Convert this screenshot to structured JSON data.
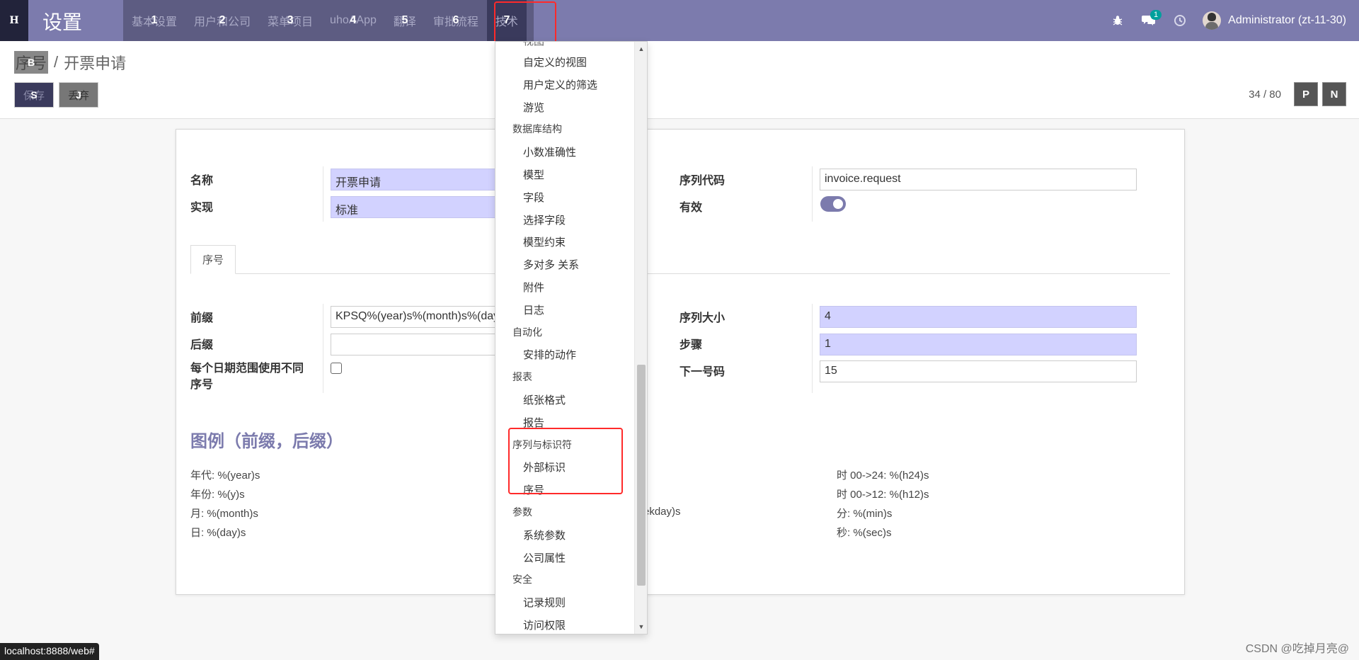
{
  "topbar": {
    "apps_hint": "H",
    "brand": "设置",
    "menus": [
      {
        "label": "基本设置",
        "hint": "1"
      },
      {
        "label": "用户和公司",
        "hint": "2"
      },
      {
        "label": "菜单项目",
        "hint": "3"
      },
      {
        "label": "uhoAApp",
        "hint": "4"
      },
      {
        "label": "翻译",
        "hint": "5"
      },
      {
        "label": "审批流程",
        "hint": "6"
      },
      {
        "label": "技术",
        "hint": "7"
      }
    ],
    "chat_badge": "1",
    "user_name": "Administrator (zt-11-30)"
  },
  "control": {
    "breadcrumb_parent": "序号",
    "breadcrumb_parent_hint": "B",
    "breadcrumb_sep": "/",
    "breadcrumb_current": "开票申请",
    "save_label": "保存",
    "save_hint": "S",
    "discard_label": "丢弃",
    "discard_hint": "J",
    "pager_text": "34 / 80",
    "pager_prev": "P",
    "pager_next": "N"
  },
  "form": {
    "name_label": "名称",
    "name_value": "开票申请",
    "impl_label": "实现",
    "impl_value": "标准",
    "code_label": "序列代码",
    "code_value": "invoice.request",
    "active_label": "有效",
    "tab_label": "序号",
    "prefix_label": "前缀",
    "prefix_value": "KPSQ%(year)s%(month)s%(day)s",
    "suffix_label": "后缀",
    "suffix_value": "",
    "date_range_label": "每个日期范围使用不同序号",
    "size_label": "序列大小",
    "size_value": "4",
    "step_label": "步骤",
    "step_value": "1",
    "next_label": "下一号码",
    "next_value": "15",
    "legend_title": "图例（前缀，后缀）",
    "legend_col1": [
      "年代: %(year)s",
      "年份: %(y)s",
      "月: %(month)s",
      "日: %(day)s"
    ],
    "legend_col2_fragment": "ekday)s",
    "legend_col3": [
      "时 00->24: %(h24)s",
      "时 00->12: %(h12)s",
      "分: %(min)s",
      "秒: %(sec)s"
    ]
  },
  "dropdown": {
    "partial_top": "视图",
    "entries": [
      {
        "type": "item",
        "label": "自定义的视图"
      },
      {
        "type": "item",
        "label": "用户定义的筛选"
      },
      {
        "type": "item",
        "label": "游览"
      },
      {
        "type": "header",
        "label": "数据库结构"
      },
      {
        "type": "item",
        "label": "小数准确性"
      },
      {
        "type": "item",
        "label": "模型"
      },
      {
        "type": "item",
        "label": "字段"
      },
      {
        "type": "item",
        "label": "选择字段"
      },
      {
        "type": "item",
        "label": "模型约束"
      },
      {
        "type": "item",
        "label": "多对多 关系"
      },
      {
        "type": "item",
        "label": "附件"
      },
      {
        "type": "item",
        "label": "日志"
      },
      {
        "type": "header",
        "label": "自动化"
      },
      {
        "type": "item",
        "label": "安排的动作"
      },
      {
        "type": "header",
        "label": "报表"
      },
      {
        "type": "item",
        "label": "纸张格式"
      },
      {
        "type": "item",
        "label": "报告"
      },
      {
        "type": "header",
        "label": "序列与标识符"
      },
      {
        "type": "item",
        "label": "外部标识"
      },
      {
        "type": "item",
        "label": "序号"
      },
      {
        "type": "header",
        "label": "参数"
      },
      {
        "type": "item",
        "label": "系统参数"
      },
      {
        "type": "item",
        "label": "公司属性"
      },
      {
        "type": "header",
        "label": "安全"
      },
      {
        "type": "item",
        "label": "记录规则"
      },
      {
        "type": "item",
        "label": "访问权限"
      }
    ]
  },
  "status_url": "localhost:8888/web#",
  "watermark": "CSDN @吃掉月亮@",
  "colors": {
    "brand": "#7c7bad",
    "required_field": "#d2d2ff",
    "annotation_red": "#ff2a2a"
  }
}
